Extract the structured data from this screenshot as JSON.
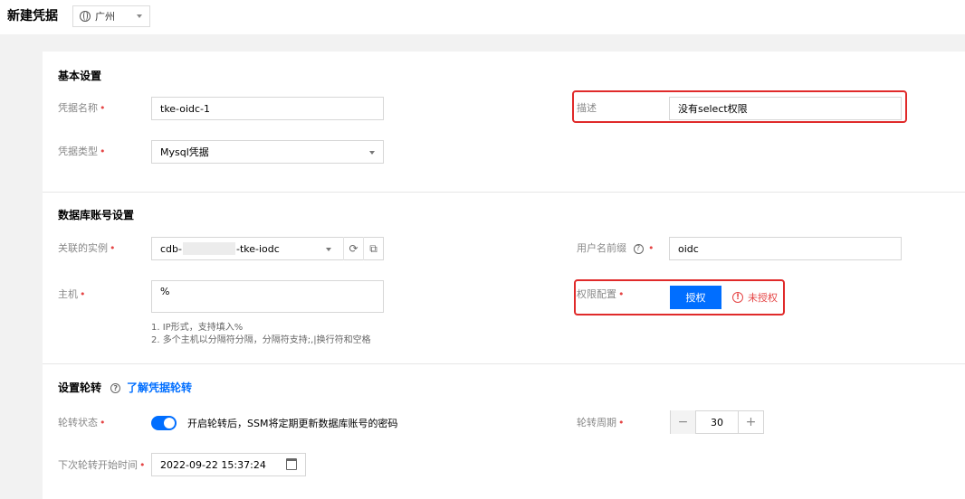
{
  "header": {
    "title": "新建凭据",
    "region": "广州"
  },
  "basic": {
    "section_title": "基本设置",
    "name_label": "凭据名称",
    "name_value": "tke-oidc-1",
    "type_label": "凭据类型",
    "type_value": "Mysql凭据",
    "desc_label": "描述",
    "desc_value": "没有select权限"
  },
  "db": {
    "section_title": "数据库账号设置",
    "instance_label": "关联的实例",
    "instance_prefix": "cdb-",
    "instance_suffix": "-tke-iodc",
    "host_label": "主机",
    "host_value": "%",
    "host_hint_1": "1. IP形式，支持填入%",
    "host_hint_2": "2. 多个主机以分隔符分隔，分隔符支持;,|换行符和空格",
    "prefix_label": "用户名前缀",
    "prefix_value": "oidc",
    "perm_label": "权限配置",
    "auth_button": "授权",
    "unauthorized": "未授权"
  },
  "rotation": {
    "section_title": "设置轮转",
    "learn_link": "了解凭据轮转",
    "status_label": "轮转状态",
    "status_text": "开启轮转后，SSM将定期更新数据库账号的密码",
    "period_label": "轮转周期",
    "period_value": "30",
    "next_label": "下次轮转开始时间",
    "next_value": "2022-09-22 15:37:24"
  },
  "icons": {
    "globe": "globe-icon",
    "refresh": "refresh-icon",
    "external": "external-link-icon",
    "help": "help-circle-icon",
    "warning": "warning-circle-icon",
    "calendar": "calendar-icon",
    "minus": "minus-icon",
    "plus": "plus-icon"
  },
  "colors": {
    "primary": "#006eff",
    "danger": "#e54545",
    "highlight_box": "#e02a2a"
  }
}
